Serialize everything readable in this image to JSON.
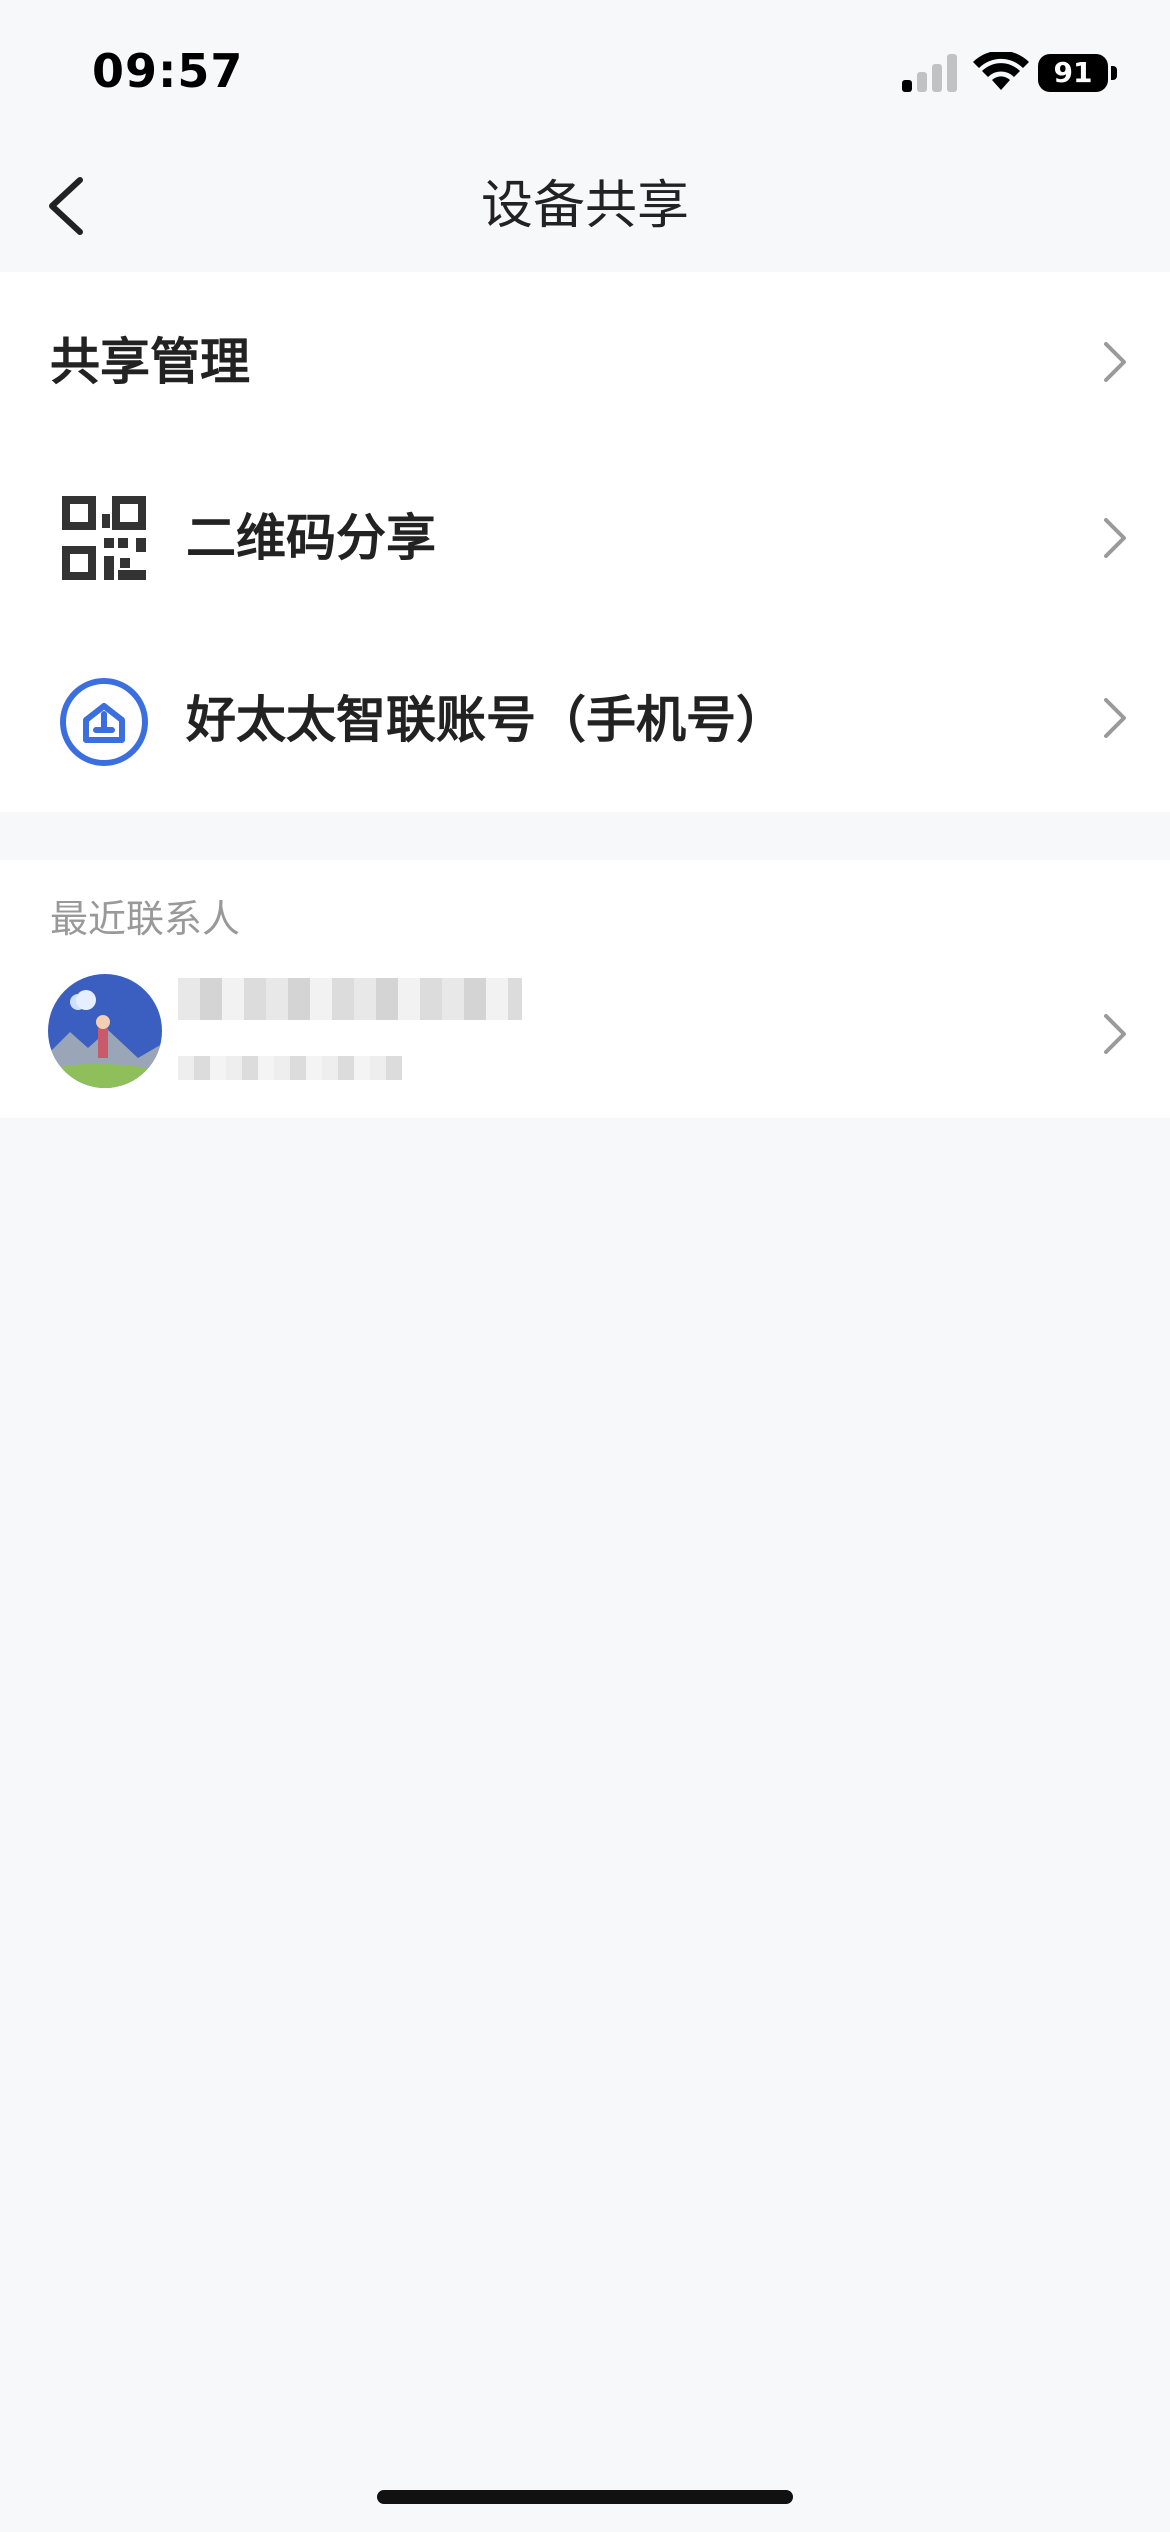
{
  "status_bar": {
    "time": "09:57",
    "battery": "91",
    "icons": [
      "cellular-signal-icon",
      "wifi-icon",
      "battery-icon"
    ]
  },
  "nav": {
    "title": "设备共享",
    "back_icon": "chevron-left-icon"
  },
  "share_menu": {
    "management_label": "共享管理",
    "qr_label": "二维码分享",
    "qr_icon": "qr-code-icon",
    "account_label": "好太太智联账号（手机号）",
    "account_icon": "home-account-icon",
    "accent_color": "#3b6fe0"
  },
  "recent": {
    "section_label": "最近联系人",
    "contacts": [
      {
        "avatar_icon": "avatar-image"
      }
    ]
  }
}
